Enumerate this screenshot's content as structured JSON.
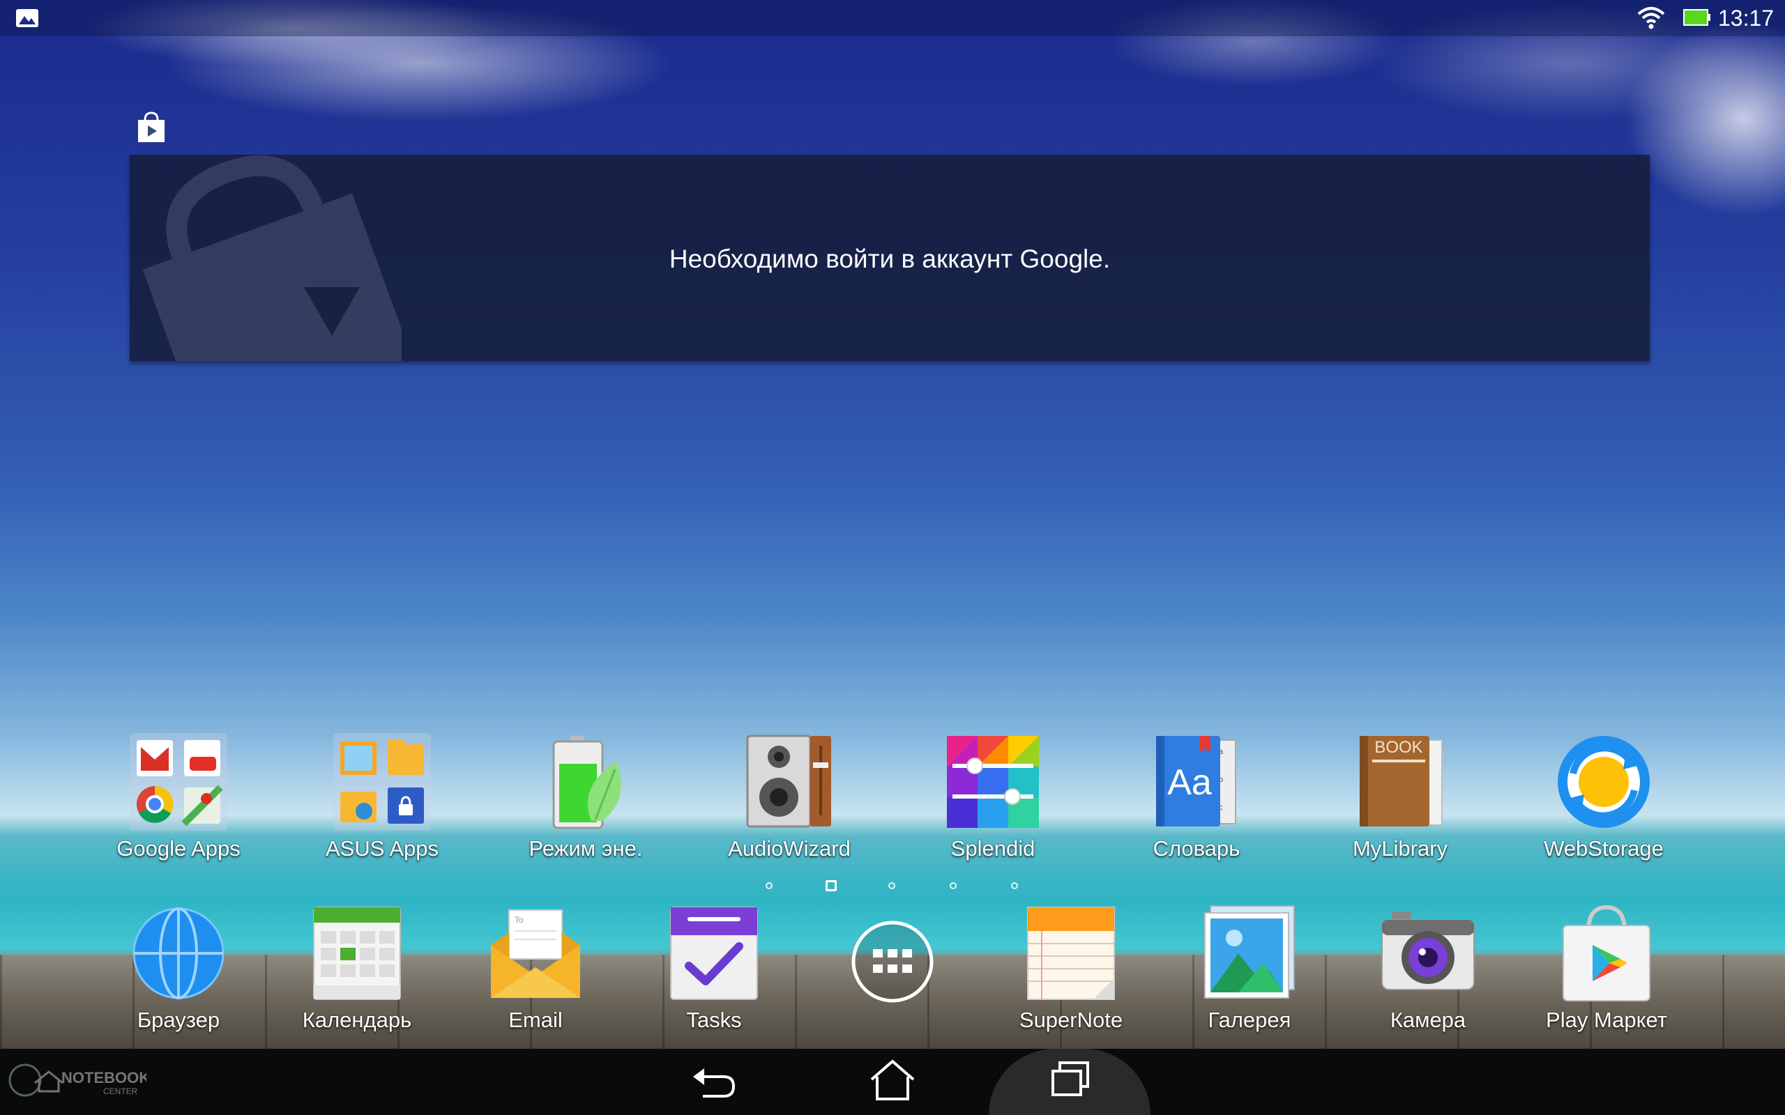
{
  "status_bar": {
    "time": "13:17",
    "left_icon": "gallery-notification-icon",
    "wifi_icon": "wifi-icon",
    "battery_icon": "battery-icon"
  },
  "widget": {
    "icon": "play-store-bag-icon",
    "message": "Необходимо войти в аккаунт Google."
  },
  "home_row": [
    {
      "label": "Google Apps",
      "icon": "google-apps-folder-icon"
    },
    {
      "label": "ASUS Apps",
      "icon": "asus-apps-folder-icon"
    },
    {
      "label": "Режим эне.",
      "icon": "power-saver-icon"
    },
    {
      "label": "AudioWizard",
      "icon": "audiowizard-speaker-icon"
    },
    {
      "label": "Splendid",
      "icon": "splendid-icon"
    },
    {
      "label": "Словарь",
      "icon": "dictionary-icon"
    },
    {
      "label": "MyLibrary",
      "icon": "mylibrary-book-icon"
    },
    {
      "label": "WebStorage",
      "icon": "webstorage-icon"
    }
  ],
  "dock": [
    {
      "label": "Браузер",
      "icon": "browser-globe-icon"
    },
    {
      "label": "Календарь",
      "icon": "calendar-icon"
    },
    {
      "label": "Email",
      "icon": "email-envelope-icon"
    },
    {
      "label": "Tasks",
      "icon": "tasks-icon"
    },
    {
      "label": "",
      "icon": "all-apps-icon"
    },
    {
      "label": "SuperNote",
      "icon": "supernote-icon"
    },
    {
      "label": "Галерея",
      "icon": "gallery-icon"
    },
    {
      "label": "Камера",
      "icon": "camera-icon"
    },
    {
      "label": "Play Маркет",
      "icon": "play-market-icon"
    }
  ],
  "pager": {
    "count": 5,
    "active_index": 1
  },
  "nav_bar": {
    "back": "back-icon",
    "home": "home-icon",
    "recents": "recent-apps-icon"
  },
  "watermark_text": "NOTEBOOK CENTER"
}
